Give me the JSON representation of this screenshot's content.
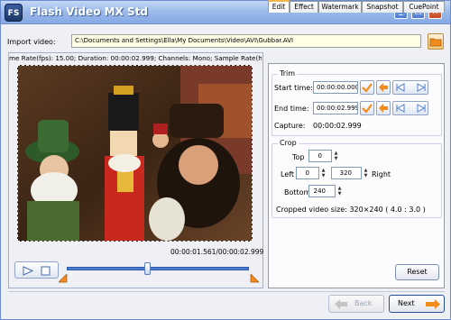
{
  "window": {
    "title": "Flash Video MX Std",
    "logo_text": "FS",
    "minimize": "_",
    "maximize": "□",
    "close": "×"
  },
  "import": {
    "label": "Import video:",
    "path": "C:\\Documents and Settings\\Ella\\My Documents\\Video\\AVI\\Gubbar.AVI"
  },
  "player": {
    "info": "me Rate(fps): 15.00;  Duration: 00:00:02.999;  Channels: Mono;  Sample Rate(hz",
    "time": "00:00:01.561/00:00:02.999",
    "seek_percent": 44
  },
  "tabs": [
    "Edit",
    "Effect",
    "Watermark",
    "Snapshot",
    "CuePoint"
  ],
  "trim": {
    "title": "Trim",
    "start_label": "Start time:",
    "start_value": "00:00:00.000",
    "end_label": "End time:",
    "end_value": "00:00:02.999",
    "capture_label": "Capture:",
    "capture_value": "00:00:02.999"
  },
  "crop": {
    "title": "Crop",
    "top_label": "Top",
    "top_value": "0",
    "left_label": "Left",
    "left_value": "0",
    "right_value": "320",
    "right_label": "Right",
    "bottom_label": "Bottom",
    "bottom_value": "240",
    "size_text": "Cropped video size: 320×240 ( 4.0 : 3.0 )"
  },
  "buttons": {
    "reset": "Reset",
    "back": "Back",
    "next": "Next"
  },
  "colors": {
    "accent_orange": "#f28b1e",
    "titlebar_blue": "#86a9e3"
  }
}
